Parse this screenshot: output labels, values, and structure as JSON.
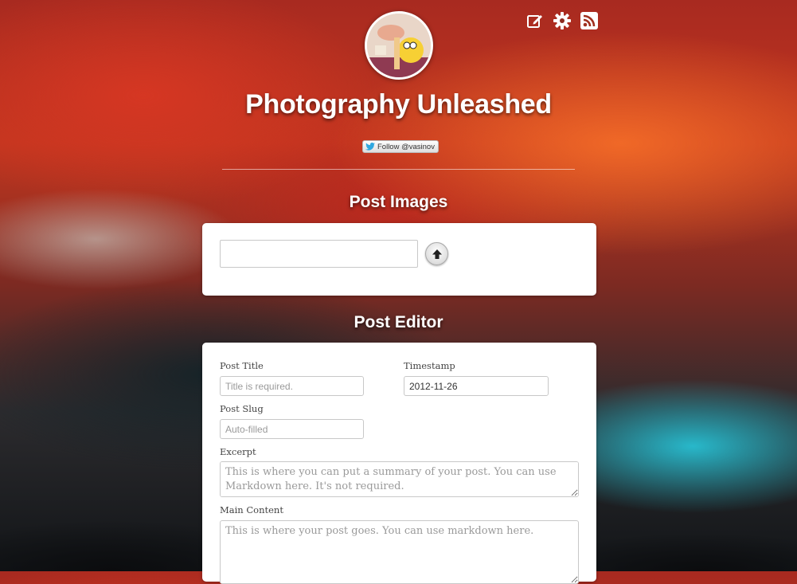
{
  "header": {
    "site_title": "Photography Unleashed",
    "twitter_follow_label": "Follow @vasinov",
    "icons": [
      "edit-icon",
      "gear-icon",
      "rss-icon"
    ]
  },
  "post_images": {
    "heading": "Post Images",
    "upload_value": ""
  },
  "post_editor": {
    "heading": "Post Editor",
    "fields": {
      "post_title": {
        "label": "Post Title",
        "placeholder": "Title is required.",
        "value": ""
      },
      "timestamp": {
        "label": "Timestamp",
        "value": "2012-11-26"
      },
      "post_slug": {
        "label": "Post Slug",
        "placeholder": "Auto-filled",
        "value": ""
      },
      "excerpt": {
        "label": "Excerpt",
        "placeholder": "This is where you can put a summary of your post. You can use Markdown here. It's not required."
      },
      "main_content": {
        "label": "Main Content",
        "placeholder": "This is where your post goes. You can use markdown here."
      }
    }
  },
  "colors": {
    "twitter_blue": "#2ea7e0",
    "panel_bg": "#ffffff",
    "heading_text": "#ffffff"
  }
}
